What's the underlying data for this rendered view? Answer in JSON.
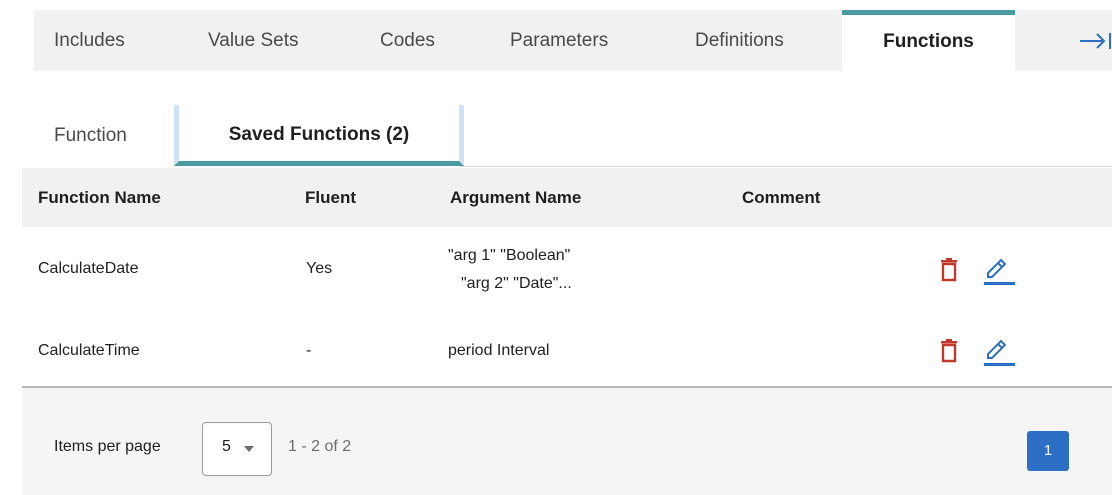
{
  "top_tabs": [
    "Includes",
    "Value Sets",
    "Codes",
    "Parameters",
    "Definitions",
    "Functions"
  ],
  "active_top_tab": "Functions",
  "sub_tabs": {
    "function": "Function",
    "saved": "Saved Functions (2)"
  },
  "table": {
    "columns": [
      "Function Name",
      "Fluent",
      "Argument Name",
      "Comment"
    ],
    "rows": [
      {
        "name": "CalculateDate",
        "fluent": "Yes",
        "args_line1": "\"arg 1\" \"Boolean\"",
        "args_line2": "\"arg 2\" \"Date\"...",
        "comment": ""
      },
      {
        "name": "CalculateTime",
        "fluent": "-",
        "args_line1": "period Interval",
        "args_line2": "",
        "comment": ""
      }
    ]
  },
  "pagination": {
    "items_per_page_label": "Items per page",
    "items_per_page_value": "5",
    "range": "1 - 2 of 2",
    "current_page": "1"
  },
  "colors": {
    "accent_teal": "#4b9aa2",
    "delete_red": "#c0392b",
    "edit_blue": "#2d6fc4",
    "page_blue": "#2d6fc4"
  }
}
